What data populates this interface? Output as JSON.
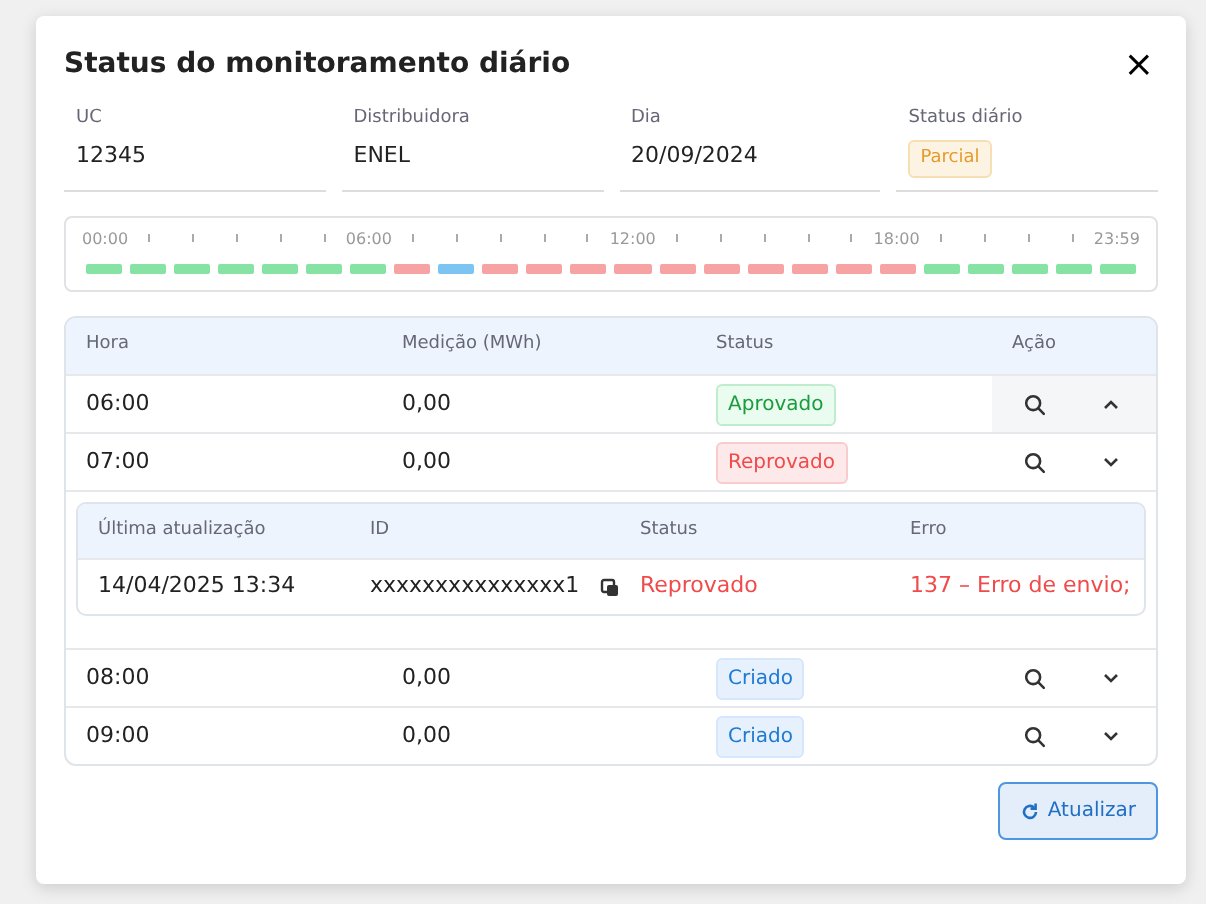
{
  "modal": {
    "title": "Status do monitoramento diário",
    "close": "×"
  },
  "info": [
    {
      "label": "UC",
      "value": "12345",
      "kind": "text"
    },
    {
      "label": "Distribuidora",
      "value": "ENEL",
      "kind": "text"
    },
    {
      "label": "Dia",
      "value": "20/09/2024",
      "kind": "text"
    },
    {
      "label": "Status diário",
      "value": "Parcial",
      "kind": "badge"
    }
  ],
  "timeline": {
    "labels": [
      "00:00",
      "06:00",
      "12:00",
      "18:00",
      "23:59"
    ],
    "segments": [
      {
        "color": "#86e3a3"
      },
      {
        "color": "#86e3a3"
      },
      {
        "color": "#86e3a3"
      },
      {
        "color": "#86e3a3"
      },
      {
        "color": "#86e3a3"
      },
      {
        "color": "#86e3a3"
      },
      {
        "color": "#86e3a3"
      },
      {
        "color": "#f7a3a3"
      },
      {
        "color": "#7cc5f2"
      },
      {
        "color": "#f7a3a3"
      },
      {
        "color": "#f7a3a3"
      },
      {
        "color": "#f7a3a3"
      },
      {
        "color": "#f7a3a3"
      },
      {
        "color": "#f7a3a3"
      },
      {
        "color": "#f7a3a3"
      },
      {
        "color": "#f7a3a3"
      },
      {
        "color": "#f7a3a3"
      },
      {
        "color": "#f7a3a3"
      },
      {
        "color": "#f7a3a3"
      },
      {
        "color": "#86e3a3"
      },
      {
        "color": "#86e3a3"
      },
      {
        "color": "#86e3a3"
      },
      {
        "color": "#86e3a3"
      },
      {
        "color": "#86e3a3"
      }
    ]
  },
  "table": {
    "columns": [
      "Hora",
      "Medição (MWh)",
      "Status",
      "Ação"
    ],
    "rows": [
      {
        "kind": "row",
        "hora": "06:00",
        "medicao": "0,00",
        "status": {
          "label": "Aprovado",
          "kind": "approved"
        },
        "expanded": true
      },
      {
        "kind": "row",
        "hora": "07:00",
        "medicao": "0,00",
        "status": {
          "label": "Reprovado",
          "kind": "rejected"
        },
        "expanded": false
      },
      {
        "kind": "details",
        "columns": [
          "Última atualização",
          "ID",
          "Status",
          "Erro"
        ],
        "values": [
          "14/04/2025 13:34",
          "xxxxxxxxxxxxxxx1",
          "Reprovado",
          "137 – Erro de envio;"
        ]
      },
      {
        "kind": "row",
        "hora": "08:00",
        "medicao": "0,00",
        "status": {
          "label": "Criado",
          "kind": "created"
        },
        "expanded": false
      },
      {
        "kind": "row",
        "hora": "09:00",
        "medicao": "0,00",
        "status": {
          "label": "Criado",
          "kind": "created"
        },
        "expanded": false
      }
    ]
  },
  "refresh_button": "Atualizar"
}
